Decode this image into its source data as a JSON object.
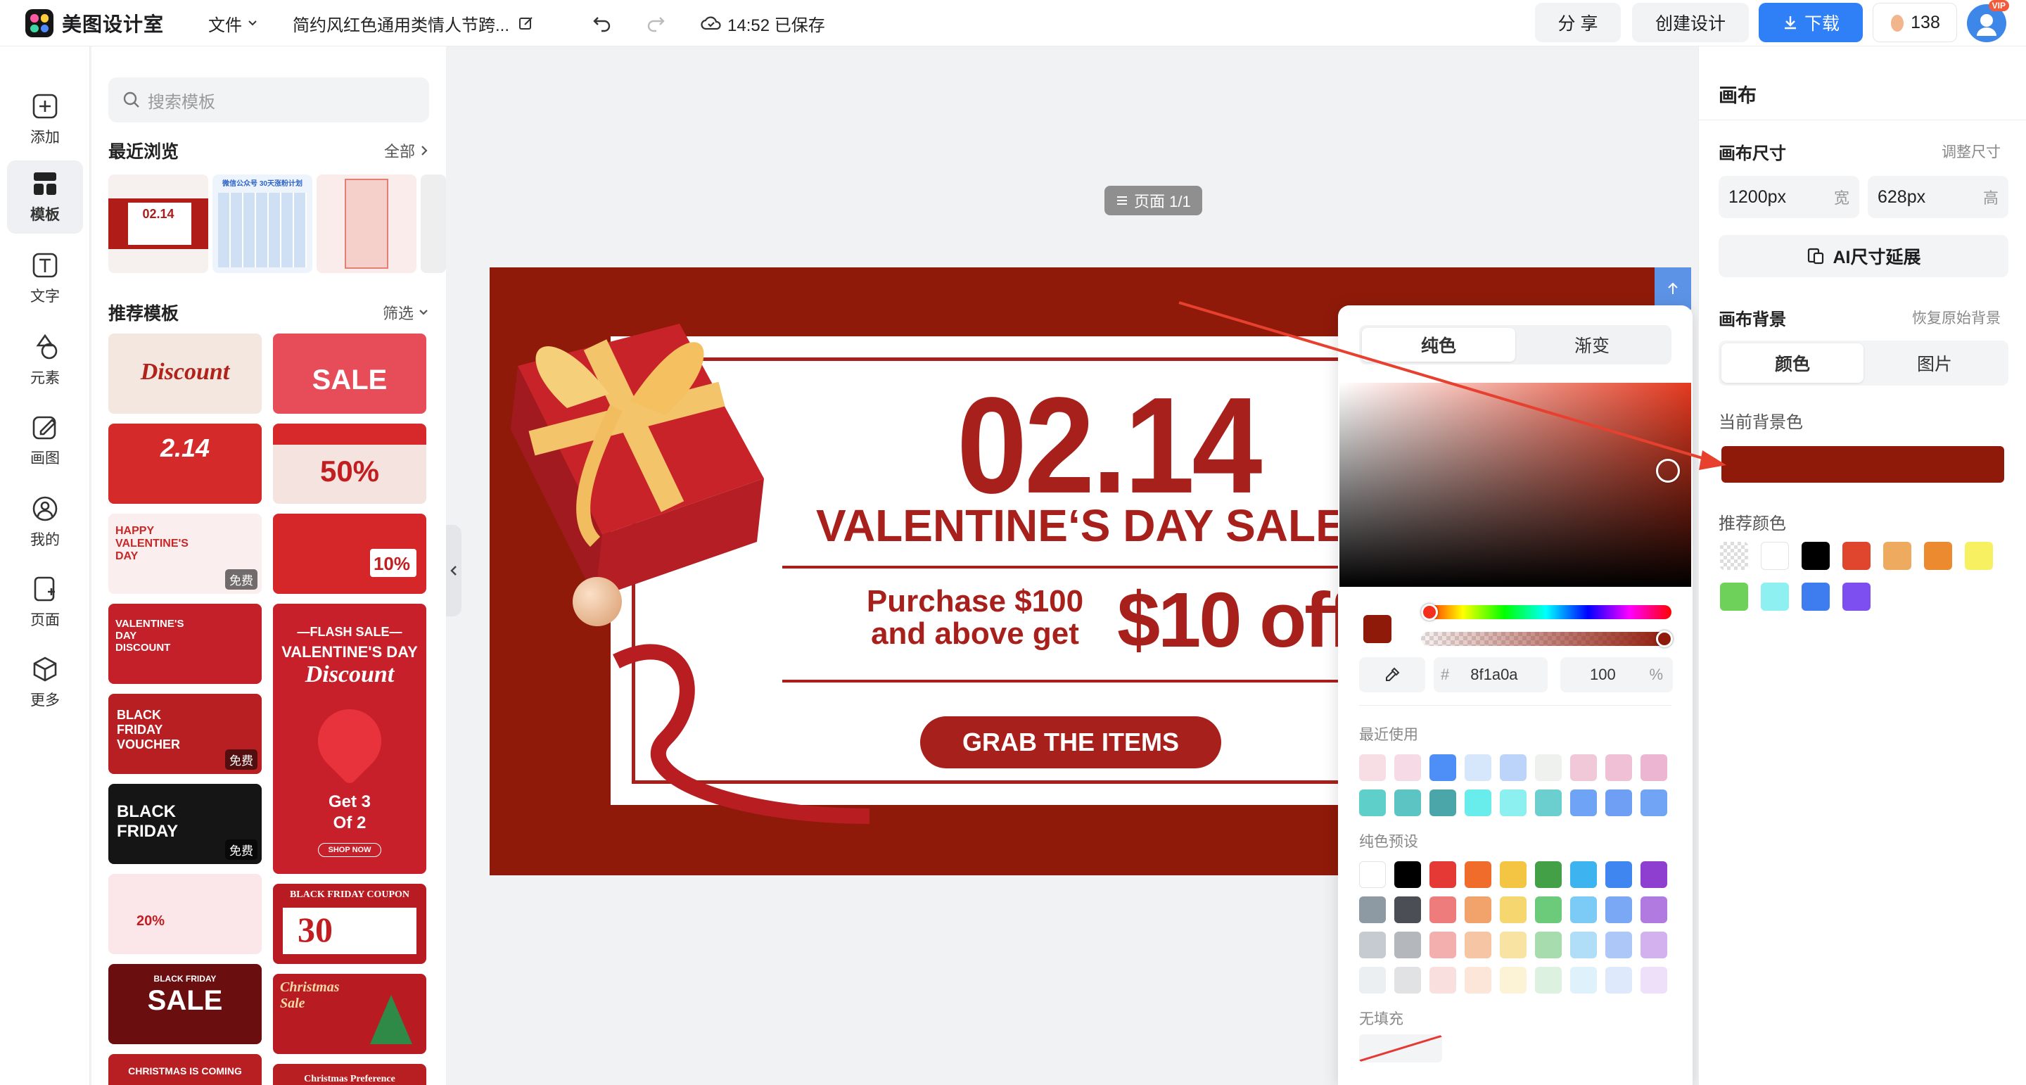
{
  "topbar": {
    "brand": "美图设计室",
    "file_menu": "文件",
    "doc_title": "简约风红色通用类情人节跨...",
    "save_status": "14:52 已保存",
    "share": "分 享",
    "create": "创建设计",
    "download": "下载",
    "credits": "138",
    "vip": "VIP"
  },
  "rail": [
    {
      "label": "添加",
      "icon": "add-icon"
    },
    {
      "label": "模板",
      "icon": "template-icon"
    },
    {
      "label": "文字",
      "icon": "text-icon"
    },
    {
      "label": "元素",
      "icon": "elements-icon"
    },
    {
      "label": "画图",
      "icon": "draw-icon"
    },
    {
      "label": "我的",
      "icon": "user-icon"
    },
    {
      "label": "页面",
      "icon": "pages-icon"
    },
    {
      "label": "更多",
      "icon": "more-icon"
    }
  ],
  "panel": {
    "search_placeholder": "搜索模板",
    "recent_title": "最近浏览",
    "recent_all": "全部",
    "recommended_title": "推荐模板",
    "filter": "筛选",
    "free_badge": "免费",
    "thumb_texts": {
      "r1": "02.14",
      "r2": "微信公众号 30天涨粉计划",
      "a1": "Discount",
      "a2": "SALE",
      "b1": "2.14",
      "b2": "50%",
      "c1": "HAPPY VALENTINE'S DAY",
      "c2": "10%",
      "d1": "VALENTINE'S DAY DISCOUNT",
      "d2a": "—FLASH SALE—",
      "d2b": "VALENTINE'S DAY",
      "d2c": "Discount",
      "d2d": "Get 3",
      "d2e": "Of 2",
      "d2f": "SHOP NOW",
      "e1": "BLACK FRIDAY VOUCHER",
      "f1": "BLACK FRIDAY",
      "g1": "20%",
      "g2": "30",
      "g2t": "BLACK FRIDAY COUPON",
      "h1": "SALE",
      "h1t": "BLACK FRIDAY",
      "h2": "Christmas Sale",
      "i1": "CHRISTMAS IS COMING",
      "i2": "Christmas Preference"
    }
  },
  "canvas": {
    "page_indicator": "页面 1/1",
    "design": {
      "date": "02.14",
      "headline": "VALENTINE‘S DAY SALE",
      "purchase_line1": "Purchase $100",
      "purchase_line2": "and above get",
      "offer": "$10 off",
      "cta": "GRAB THE ITEMS",
      "bg_color": "#8f1a0a",
      "accent_color": "#a8201c"
    }
  },
  "color_picker": {
    "tab_solid": "纯色",
    "tab_gradient": "渐变",
    "hash": "#",
    "hex_value": "8f1a0a",
    "opacity": "100",
    "percent": "%",
    "recent_label": "最近使用",
    "preset_label": "纯色预设",
    "no_fill_label": "无填充",
    "recent_colors": [
      [
        "#f7dde4",
        "#f6dbe6",
        "#4e8ef7",
        "#d6e6fb",
        "#bcd4fa",
        "#eef1ee",
        "#f0c8d8",
        "#efc0d6",
        "#ecb6d2"
      ],
      [
        "#5ecfc9",
        "#5cc5c4",
        "#4aa6a8",
        "#69ecec",
        "#8cf0f0",
        "#6ccfcf",
        "#6ea3f5",
        "#6e9ff4",
        "#71a4f4"
      ]
    ],
    "preset_colors": [
      [
        "#ffffff",
        "#000000",
        "#e53935",
        "#ef6c2b",
        "#f4c542",
        "#43a047",
        "#3db4f0",
        "#3f86f0",
        "#8e3fcf"
      ],
      [
        "#8d9aa3",
        "#4b4f55",
        "#ef7c7c",
        "#f2a36b",
        "#f6d66e",
        "#6ccb7a",
        "#7ccaf6",
        "#7aa8f4",
        "#b17ae0"
      ],
      [
        "#c5cbd0",
        "#b4b8bd",
        "#f3aeae",
        "#f6c5a4",
        "#f8e3a2",
        "#a6dcae",
        "#b0def8",
        "#adc8f8",
        "#d2b1ee"
      ],
      [
        "#eceff1",
        "#e0e2e4",
        "#fadfdf",
        "#fbe6d9",
        "#fcf2d5",
        "#dcf1df",
        "#dff1fb",
        "#deeafc",
        "#eee0f8"
      ]
    ]
  },
  "right_panel": {
    "title": "画布",
    "size_label": "画布尺寸",
    "resize_link": "调整尺寸",
    "width_value": "1200px",
    "width_unit": "宽",
    "height_value": "628px",
    "height_unit": "高",
    "ai_extend": "AI尺寸延展",
    "bg_label": "画布背景",
    "restore_link": "恢复原始背景",
    "tab_color": "颜色",
    "tab_image": "图片",
    "current_bg_label": "当前背景色",
    "current_bg": "#8f1a0a",
    "recommended_label": "推荐颜色",
    "recommended_colors": [
      "transparent",
      "#ffffff",
      "#000000",
      "#e0452e",
      "#eeaa5e",
      "#ec8a30",
      "#f7f060",
      "#6ed15a",
      "#8ef0f0",
      "#3d7df0",
      "#7e4ff0"
    ]
  }
}
